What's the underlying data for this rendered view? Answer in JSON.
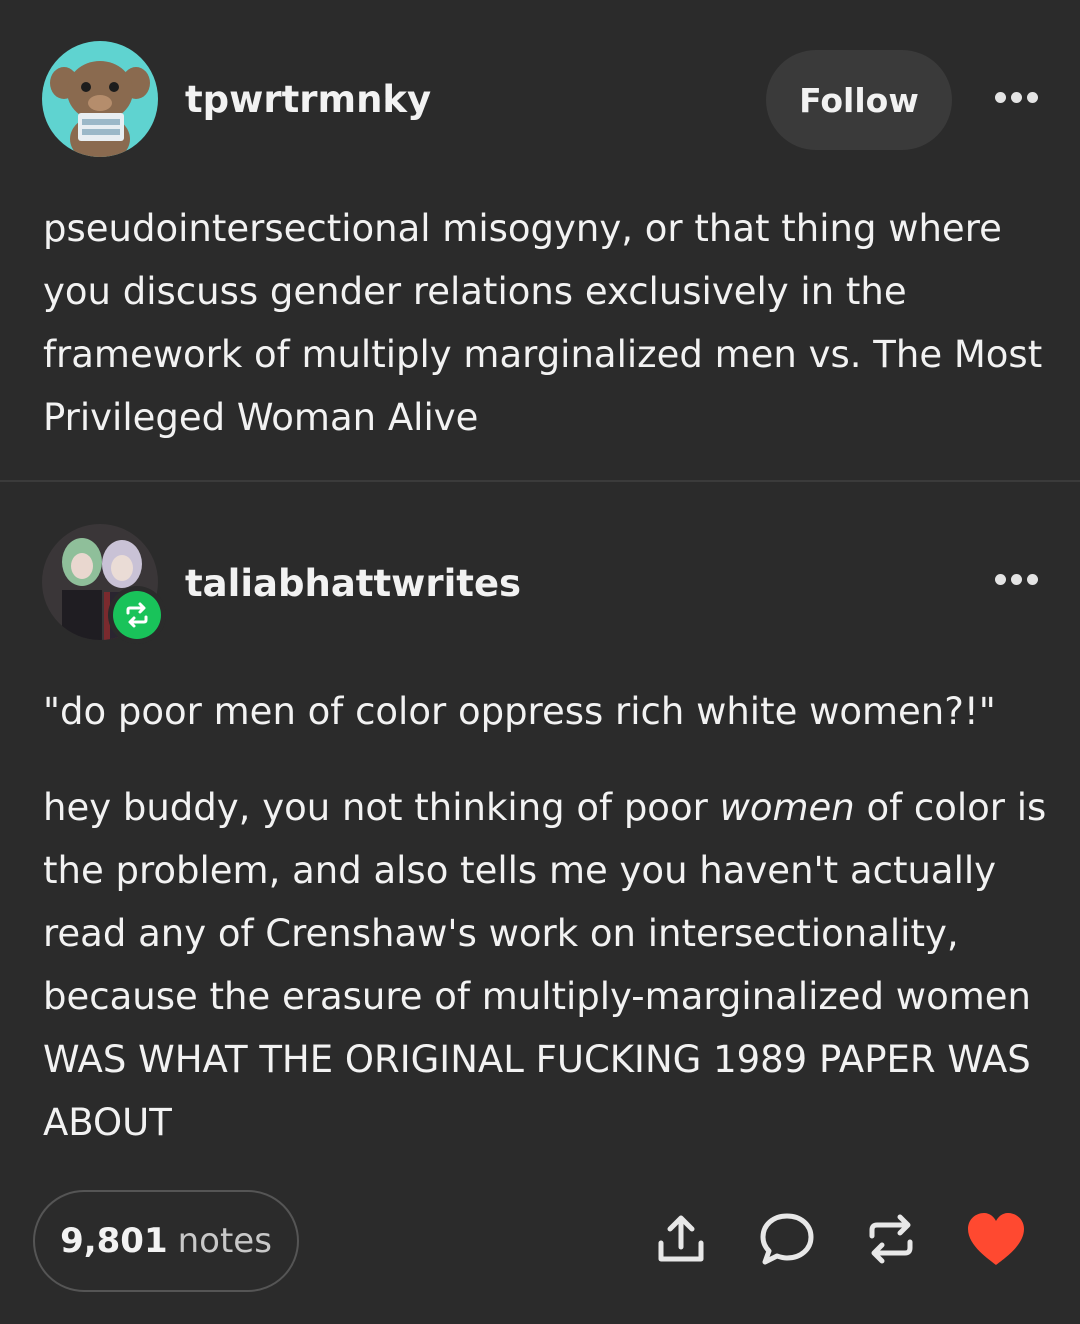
{
  "original_post": {
    "username": "tpwrtrmnky",
    "follow_label": "Follow",
    "body": "pseudointersectional misogyny, or that thing where you discuss gender relations exclusively in the framework of multiply marginalized men vs. The Most Privileged Woman Alive"
  },
  "reblog": {
    "username": "taliabhattwrites",
    "quote": "\"do poor men of color oppress rich white women?!\"",
    "reply_part1": "hey buddy, you not thinking of poor ",
    "reply_emphasis": "women",
    "reply_part2": " of color is the problem, and also tells me you haven't actually read any of Crenshaw's work on intersectionality, because the erasure of multiply-marginalized women WAS WHAT THE ORIGINAL FUCKING 1989 PAPER WAS ABOUT"
  },
  "footer": {
    "notes_count": "9,801",
    "notes_label": "notes",
    "actions": [
      "share-icon",
      "comment-icon",
      "reblog-icon",
      "heart-icon"
    ]
  },
  "colors": {
    "background": "#2b2b2b",
    "reblog_green": "#19c35a",
    "like_red": "#ff4930"
  }
}
